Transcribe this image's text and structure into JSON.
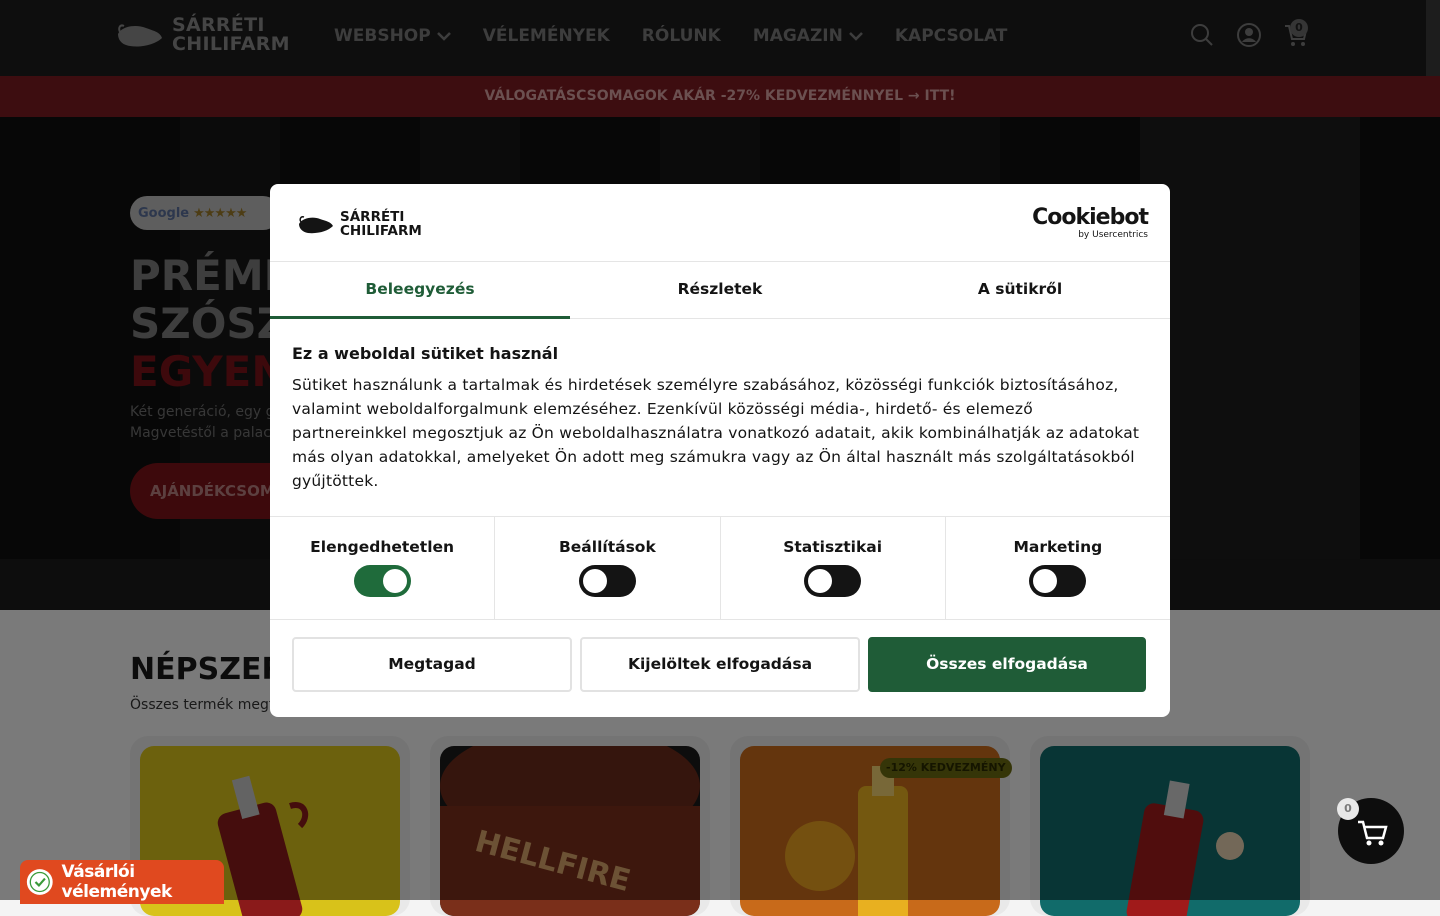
{
  "header": {
    "logo_line1": "SÁRRÉTI",
    "logo_line2": "CHILIFARM",
    "nav": [
      {
        "label": "WEBSHOP",
        "has_dropdown": true
      },
      {
        "label": "VÉLEMÉNYEK",
        "has_dropdown": false
      },
      {
        "label": "RÓLUNK",
        "has_dropdown": false
      },
      {
        "label": "MAGAZIN",
        "has_dropdown": true
      },
      {
        "label": "KAPCSOLAT",
        "has_dropdown": false
      }
    ],
    "icons": [
      "search-icon",
      "account-icon",
      "cart-icon"
    ],
    "cart_count": "0"
  },
  "promo": {
    "text": "VÁLOGATÁSCSOMAGOK AKÁR -27% KEDVEZMÉNNYEL → ITT!"
  },
  "hero": {
    "google_label": "Google",
    "stars": "★★★★★",
    "title_line1": "PRÉMIU",
    "title_line2": "SZÓSZ",
    "title_line3": "EGYEN",
    "sub_line1": "Két generáció, egy ga",
    "sub_line2": "Magvetéstől a palack",
    "button": "AJÁNDÉKCSOM"
  },
  "section": {
    "title": "NÉPSZER",
    "link": "Összes termék megte",
    "discount_badge": "-12% KEDVEZMÉNY"
  },
  "floating": {
    "reviews_label": "Vásárlói vélemények",
    "cart_count": "0"
  },
  "dialog": {
    "logo_line1": "SÁRRÉTI",
    "logo_line2": "CHILIFARM",
    "cookiebot_main": "Cookiebot",
    "cookiebot_sub": "by Usercentrics",
    "tabs": [
      {
        "label": "Beleegyezés",
        "active": true
      },
      {
        "label": "Részletek",
        "active": false
      },
      {
        "label": "A sütikről",
        "active": false
      }
    ],
    "heading": "Ez a weboldal sütiket használ",
    "body": "Sütiket használunk a tartalmak és hirdetések személyre szabásához, közösségi funkciók biztosításához, valamint weboldalforgalmunk elemzéséhez. Ezenkívül közösségi média-, hirdető- és elemező partnereinkkel megosztjuk az Ön weboldalhasználatra vonatkozó adatait, akik kombinálhatják az adatokat más olyan adatokkal, amelyeket Ön adott meg számukra vagy az Ön által használt más szolgáltatásokból gyűjtöttek.",
    "toggles": [
      {
        "label": "Elengedhetetlen",
        "on": true
      },
      {
        "label": "Beállítások",
        "on": false
      },
      {
        "label": "Statisztikai",
        "on": false
      },
      {
        "label": "Marketing",
        "on": false
      }
    ],
    "buttons": {
      "deny": "Megtagad",
      "accept_selected": "Kijelöltek elfogadása",
      "accept_all": "Összes elfogadása"
    }
  },
  "colors": {
    "primary_green": "#1f5c37",
    "brand_red": "#d9303b",
    "header_bg": "#1d1d1d"
  }
}
